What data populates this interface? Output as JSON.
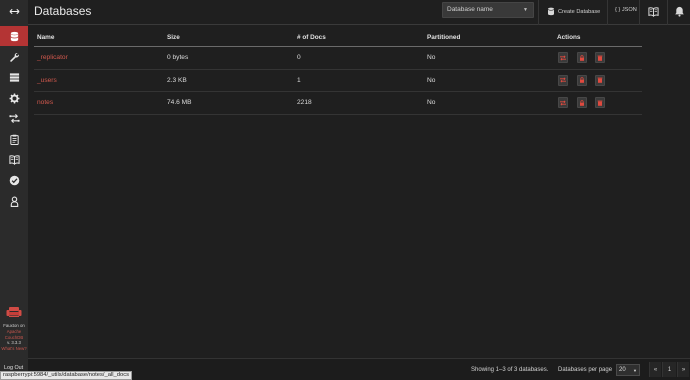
{
  "sidebar": {
    "items": [
      {
        "icon": "toggle-arrows-icon"
      },
      {
        "icon": "database-icon",
        "active": true
      },
      {
        "icon": "wrench-icon"
      },
      {
        "icon": "server-icon"
      },
      {
        "icon": "gear-icon"
      },
      {
        "icon": "replication-icon"
      },
      {
        "icon": "clipboard-icon"
      },
      {
        "icon": "book-icon"
      },
      {
        "icon": "check-circle-icon"
      },
      {
        "icon": "user-icon"
      }
    ],
    "brand_line1": "Fauxton on",
    "brand_line2": "Apache",
    "brand_line3": "CouchDB",
    "version": "v. 3.3.3",
    "whats_new": "What's New?",
    "logout": "Log Out"
  },
  "header": {
    "title": "Databases",
    "search_placeholder": "Database name",
    "create_label": "Create Database",
    "json_label": "{ } JSON"
  },
  "table": {
    "columns": [
      "Name",
      "Size",
      "# of Docs",
      "Partitioned",
      "Actions"
    ],
    "rows": [
      {
        "name": "_replicator",
        "size": "0 bytes",
        "docs": "0",
        "partitioned": "No"
      },
      {
        "name": "_users",
        "size": "2.3 KB",
        "docs": "1",
        "partitioned": "No"
      },
      {
        "name": "notes",
        "size": "74.6 MB",
        "docs": "2218",
        "partitioned": "No"
      }
    ]
  },
  "footer": {
    "showing": "Showing 1–3 of 3 databases.",
    "per_page_label": "Databases per page",
    "per_page_value": "20",
    "prev": "«",
    "page": "1",
    "next": "»"
  },
  "status_url": "raspberrypi:5984/_utils/database/notes/_all_docs",
  "colors": {
    "accent": "#b43434",
    "link": "#d1584d",
    "background": "#1f1f1f"
  }
}
